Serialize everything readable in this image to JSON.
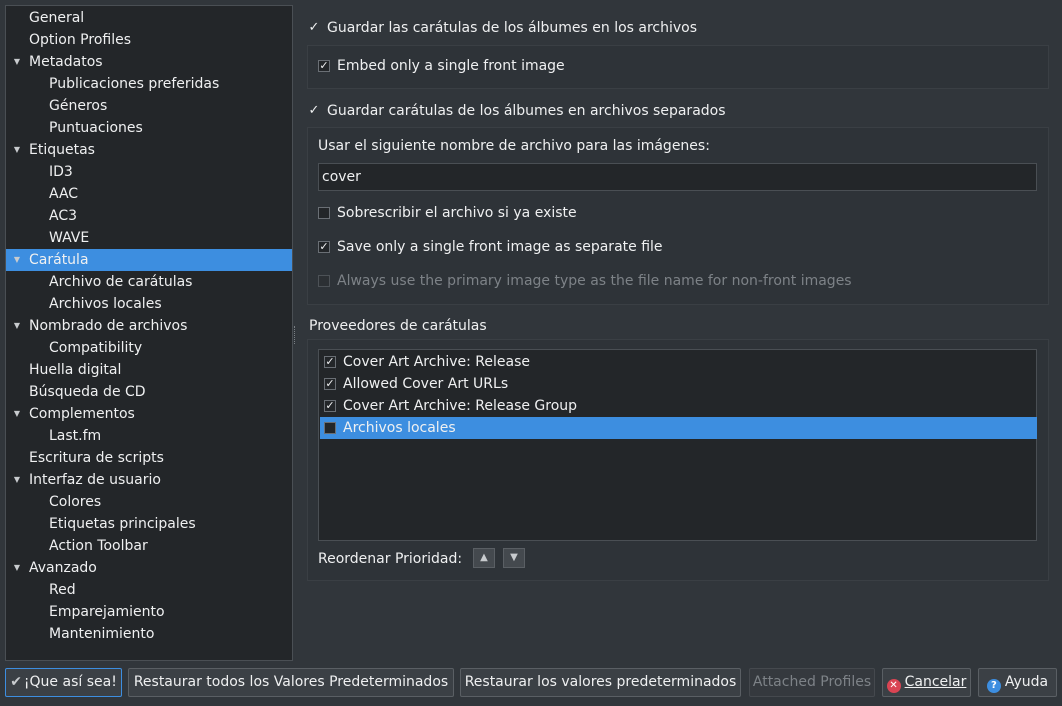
{
  "sidebar": {
    "items": [
      {
        "label": "General",
        "level": 0,
        "expandable": false
      },
      {
        "label": "Option Profiles",
        "level": 0,
        "expandable": false
      },
      {
        "label": "Metadatos",
        "level": 0,
        "expandable": true
      },
      {
        "label": "Publicaciones preferidas",
        "level": 1,
        "expandable": false
      },
      {
        "label": "Géneros",
        "level": 1,
        "expandable": false
      },
      {
        "label": "Puntuaciones",
        "level": 1,
        "expandable": false
      },
      {
        "label": "Etiquetas",
        "level": 0,
        "expandable": true
      },
      {
        "label": "ID3",
        "level": 1,
        "expandable": false
      },
      {
        "label": "AAC",
        "level": 1,
        "expandable": false
      },
      {
        "label": "AC3",
        "level": 1,
        "expandable": false
      },
      {
        "label": "WAVE",
        "level": 1,
        "expandable": false
      },
      {
        "label": "Carátula",
        "level": 0,
        "expandable": true,
        "selected": true
      },
      {
        "label": "Archivo de carátulas",
        "level": 1,
        "expandable": false
      },
      {
        "label": "Archivos locales",
        "level": 1,
        "expandable": false
      },
      {
        "label": "Nombrado de archivos",
        "level": 0,
        "expandable": true
      },
      {
        "label": "Compatibility",
        "level": 1,
        "expandable": false
      },
      {
        "label": "Huella digital",
        "level": 0,
        "expandable": false
      },
      {
        "label": "Búsqueda de CD",
        "level": 0,
        "expandable": false
      },
      {
        "label": "Complementos",
        "level": 0,
        "expandable": true
      },
      {
        "label": "Last.fm",
        "level": 1,
        "expandable": false
      },
      {
        "label": "Escritura de scripts",
        "level": 0,
        "expandable": false
      },
      {
        "label": "Interfaz de usuario",
        "level": 0,
        "expandable": true
      },
      {
        "label": "Colores",
        "level": 1,
        "expandable": false
      },
      {
        "label": "Etiquetas principales",
        "level": 1,
        "expandable": false
      },
      {
        "label": "Action Toolbar",
        "level": 1,
        "expandable": false
      },
      {
        "label": "Avanzado",
        "level": 0,
        "expandable": true
      },
      {
        "label": "Red",
        "level": 1,
        "expandable": false
      },
      {
        "label": "Emparejamiento",
        "level": 1,
        "expandable": false
      },
      {
        "label": "Mantenimiento",
        "level": 1,
        "expandable": false
      }
    ]
  },
  "options": {
    "save_in_files": {
      "label": "Guardar las carátulas de los álbumes en los archivos",
      "checked": true
    },
    "embed_single_front": {
      "label": "Embed only a single front image",
      "checked": true
    },
    "save_separate": {
      "label": "Guardar carátulas de los álbumes en archivos separados",
      "checked": true
    },
    "filename_label": "Usar el siguiente nombre de archivo para las imágenes:",
    "filename_value": "cover",
    "overwrite": {
      "label": "Sobrescribir el archivo si ya existe",
      "checked": false
    },
    "single_front_separate": {
      "label": "Save only a single front image as separate file",
      "checked": true
    },
    "primary_type_filename": {
      "label": "Always use the primary image type as the file name for non-front images",
      "checked": false,
      "disabled": true
    }
  },
  "providers": {
    "title": "Proveedores de carátulas",
    "items": [
      {
        "label": "Cover Art Archive: Release",
        "checked": true
      },
      {
        "label": "Allowed Cover Art URLs",
        "checked": true
      },
      {
        "label": "Cover Art Archive: Release Group",
        "checked": true
      },
      {
        "label": "Archivos locales",
        "checked": false,
        "selected": true
      }
    ],
    "reorder_label": "Reordenar Prioridad:"
  },
  "buttons": {
    "ok": "¡Que así sea!",
    "restore_all": "Restaurar todos los Valores Predeterminados",
    "restore": "Restaurar los valores predeterminados",
    "attached_profiles": "Attached Profiles",
    "cancel": "Cancelar",
    "help": "Ayuda"
  },
  "colors": {
    "selection": "#3d8ee0",
    "background": "#31363b",
    "field": "#232629"
  }
}
